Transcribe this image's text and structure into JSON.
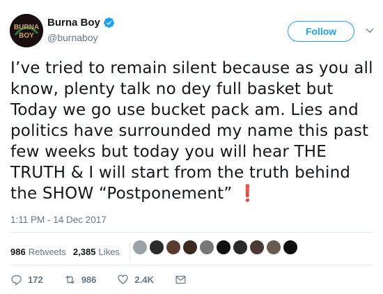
{
  "user": {
    "display_name": "Burna Boy",
    "handle": "@burnaboy",
    "avatar_text": "BURNA BOY"
  },
  "follow_label": "Follow",
  "tweet": {
    "text": "I’ve tried to remain silent because as you all know, plenty talk no dey full basket but Today we go use bucket pack am. Lies and politics have surrounded my name this past few weeks but today you will hear THE TRUTH & I will start from the truth behind the SHOW “Postponement”",
    "emoji": "❗",
    "timestamp": "1:11 PM - 14 Dec 2017"
  },
  "stats": {
    "retweets_count": "986",
    "retweets_label": "Retweets",
    "likes_count": "2,385",
    "likes_label": "Likes"
  },
  "liker_faces_colors": [
    "#9aa4a8",
    "#2b2b2b",
    "#5a3b2e",
    "#3c2a22",
    "#777777",
    "#111111",
    "#2a2a2a",
    "#4a3a36",
    "#6b5a50",
    "#0d0d0d"
  ],
  "actions": {
    "replies": "172",
    "retweets": "986",
    "likes": "2.4K"
  },
  "colors": {
    "accent": "#1da1f2",
    "muted": "#657786",
    "text": "#14171a"
  }
}
